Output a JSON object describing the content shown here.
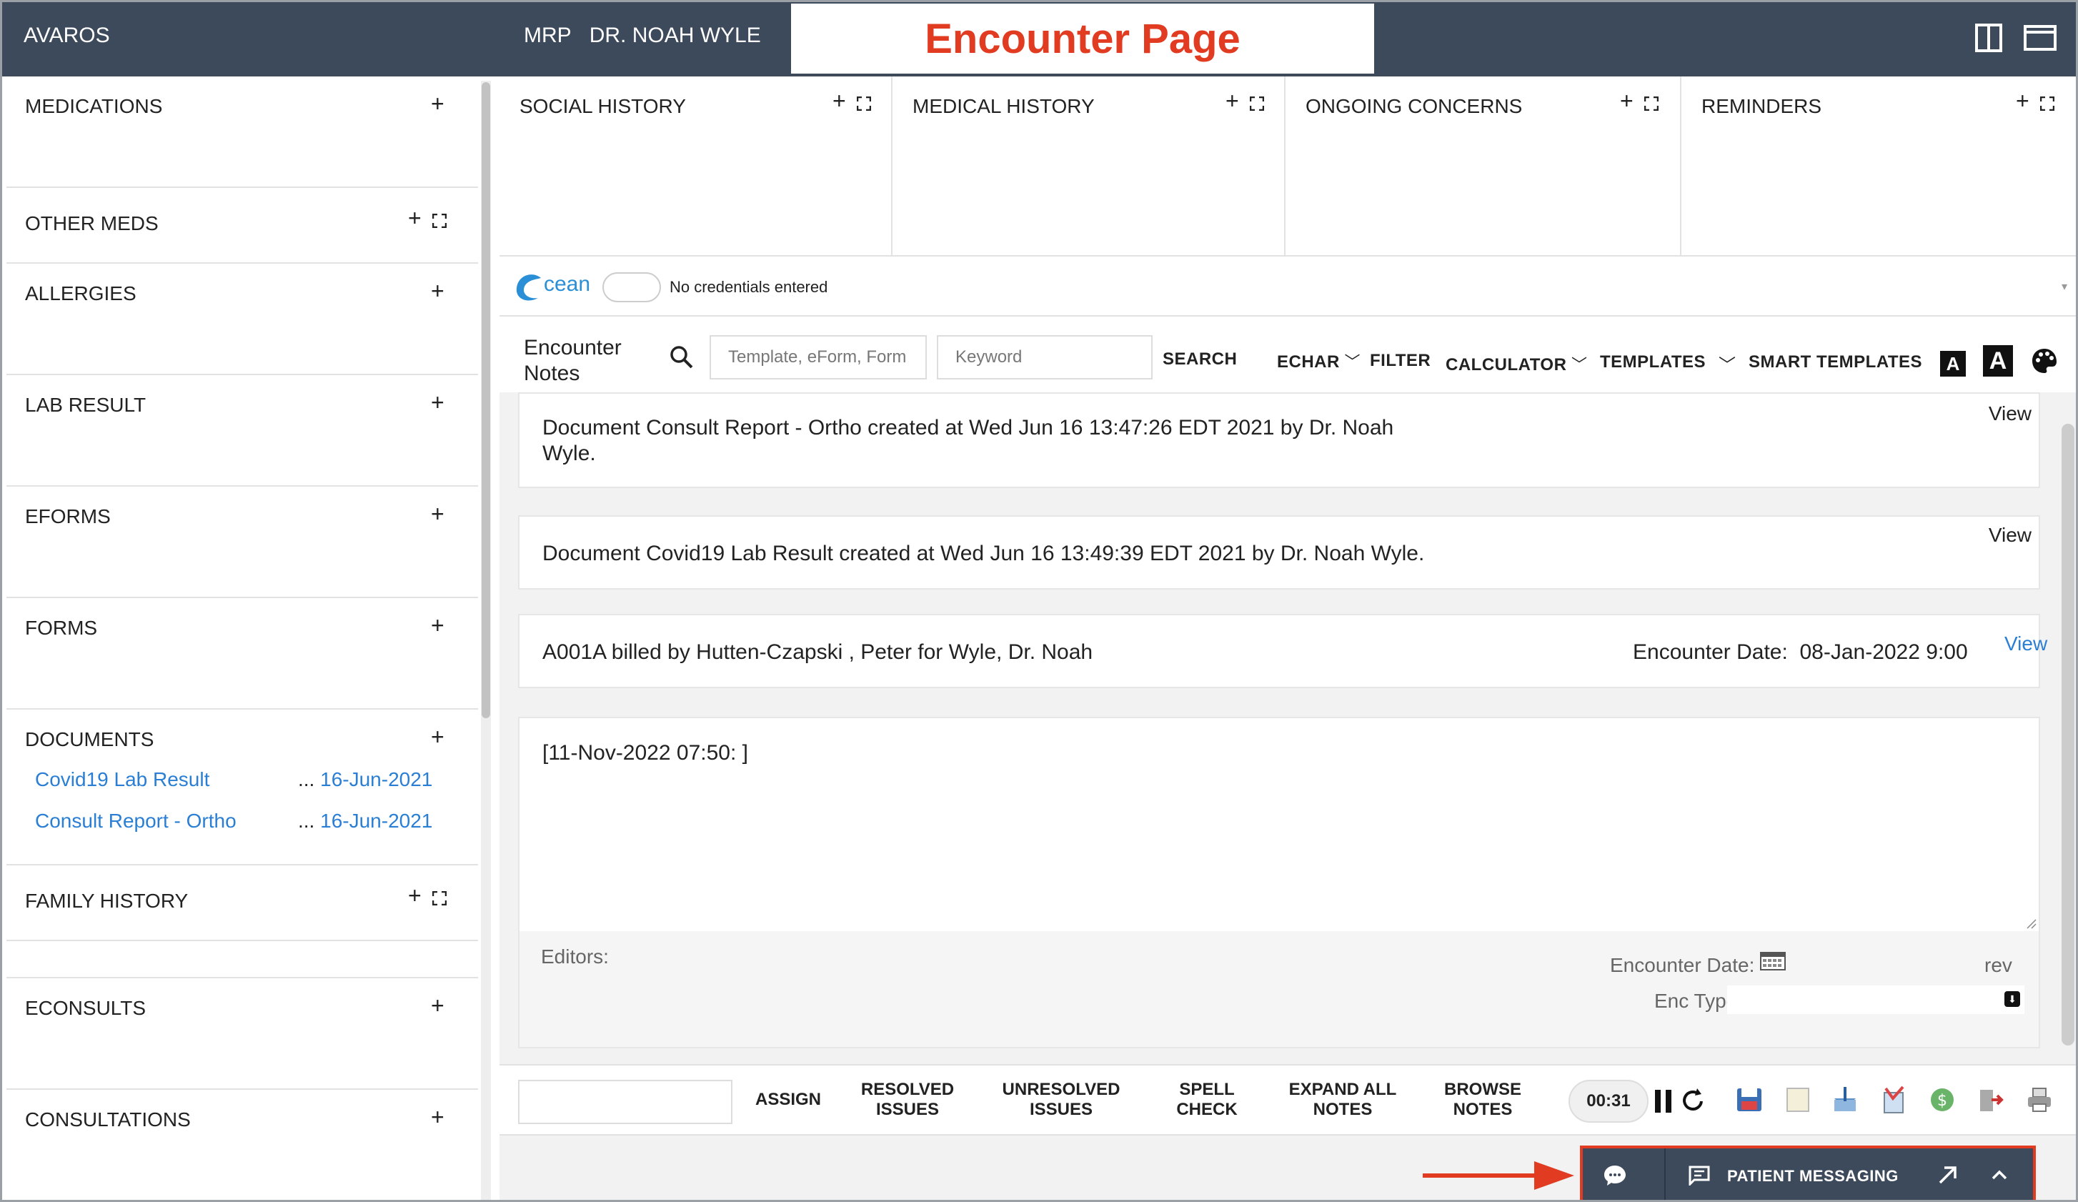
{
  "header": {
    "brand": "AVAROS",
    "mrp_label": "MRP",
    "doctor": "DR. NOAH WYLE",
    "page_title": "Encounter Page"
  },
  "sidebar": {
    "sections": [
      {
        "title": "MEDICATIONS"
      },
      {
        "title": "OTHER MEDS"
      },
      {
        "title": "ALLERGIES"
      },
      {
        "title": "LAB RESULT"
      },
      {
        "title": "EFORMS"
      },
      {
        "title": "FORMS"
      },
      {
        "title": "DOCUMENTS"
      },
      {
        "title": "FAMILY HISTORY"
      },
      {
        "title": "ECONSULTS"
      },
      {
        "title": "CONSULTATIONS"
      }
    ],
    "documents": [
      {
        "name": "Covid19 Lab Result",
        "dots": "...",
        "date": "16-Jun-2021"
      },
      {
        "name": "Consult Report - Ortho",
        "dots": "...",
        "date": "16-Jun-2021"
      }
    ],
    "plus": "+"
  },
  "top_cards": [
    {
      "title": "SOCIAL HISTORY"
    },
    {
      "title": "MEDICAL HISTORY"
    },
    {
      "title": "ONGOING CONCERNS"
    },
    {
      "title": "REMINDERS"
    }
  ],
  "ocean": {
    "logo_text": "cean",
    "status": "No credentials entered"
  },
  "toolbar": {
    "label_line1": "Encounter",
    "label_line2": "Notes",
    "template_placeholder": "Template, eForm, Form",
    "keyword_placeholder": "Keyword",
    "search": "SEARCH",
    "echart": "ECHAR",
    "filter": "FILTER",
    "calculator": "CALCULATOR",
    "templates": "TEMPLATES",
    "smart_templates": "SMART TEMPLATES",
    "font_small": "A",
    "font_large": "A"
  },
  "notes": [
    {
      "line1": "Document Consult Report - Ortho created at Wed Jun 16 13:47:26 EDT 2021 by Dr. Noah",
      "line2": "Wyle.",
      "view": "View"
    },
    {
      "line1": "Document Covid19 Lab Result created at Wed Jun 16 13:49:39 EDT 2021 by Dr. Noah Wyle.",
      "view": "View"
    },
    {
      "line1": "A001A billed by Hutten-Czapski , Peter for Wyle, Dr. Noah",
      "enc_date_label": "Encounter Date:",
      "enc_date": "08-Jan-2022 9:00",
      "view": "View"
    }
  ],
  "editor": {
    "text": "[11-Nov-2022 07:50: ]",
    "editors_label": "Editors:",
    "enc_date_label": "Encounter Date:",
    "rev": "rev",
    "enc_type_label": "Enc Type:"
  },
  "bottom": {
    "assign": "ASSIGN",
    "resolved_1": "RESOLVED",
    "resolved_2": "ISSUES",
    "unresolved_1": "UNRESOLVED",
    "unresolved_2": "ISSUES",
    "spell_1": "SPELL",
    "spell_2": "CHECK",
    "expand_1": "EXPAND ALL",
    "expand_2": "NOTES",
    "browse_1": "BROWSE",
    "browse_2": "NOTES",
    "timer": "00:31"
  },
  "patient_messaging": {
    "label": "PATIENT MESSAGING"
  },
  "colors": {
    "header_bg": "#3d4a5c",
    "title_red": "#e13b22",
    "link_blue": "#2a7fd4"
  }
}
